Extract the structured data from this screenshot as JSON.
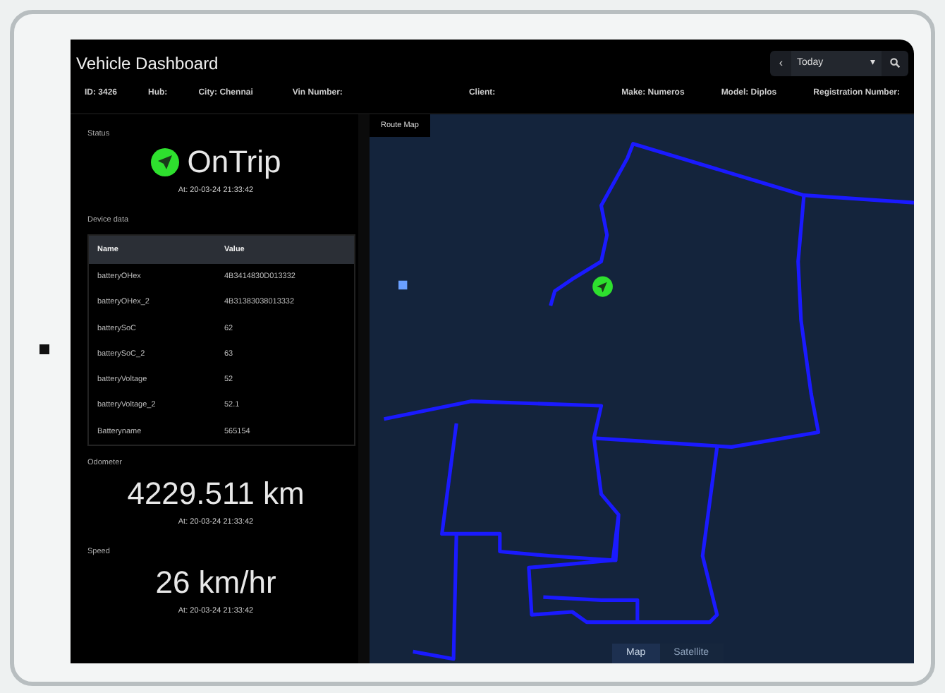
{
  "title": "Vehicle Dashboard",
  "date_nav": {
    "prev": "‹",
    "value": "Today",
    "caret": "▾"
  },
  "info": [
    {
      "label": "ID: 3426"
    },
    {
      "label": "Hub:"
    },
    {
      "label": "City: Chennai"
    },
    {
      "label": "Vin Number:"
    },
    {
      "label": "Client:"
    },
    {
      "label": "Make: Numeros"
    },
    {
      "label": "Model: Diplos"
    },
    {
      "label": "Registration Number:"
    }
  ],
  "status": {
    "label": "Status",
    "value": "OnTrip",
    "time": "At: 20-03-24 21:33:42"
  },
  "device_data": {
    "label": "Device data",
    "columns": [
      "Name",
      "Value"
    ],
    "rows": [
      [
        "batteryOHex",
        "4B3414830D013332"
      ],
      [
        "batteryOHex_2",
        "4B31383038013332"
      ],
      [
        "batterySoC",
        "62"
      ],
      [
        "batterySoC_2",
        "63"
      ],
      [
        "batteryVoltage",
        "52"
      ],
      [
        "batteryVoltage_2",
        "52.1"
      ],
      [
        "Batteryname",
        "565154"
      ]
    ]
  },
  "odometer": {
    "label": "Odometer",
    "value": "4229.511 km",
    "time": "At: 20-03-24 21:33:42"
  },
  "speed": {
    "label": "Speed",
    "value": "26 km/hr",
    "time": "At: 20-03-24 21:33:42"
  },
  "map": {
    "label": "Route Map",
    "map_types": [
      {
        "label": "Map",
        "selected": true
      },
      {
        "label": "Satellite",
        "selected": false
      }
    ]
  }
}
